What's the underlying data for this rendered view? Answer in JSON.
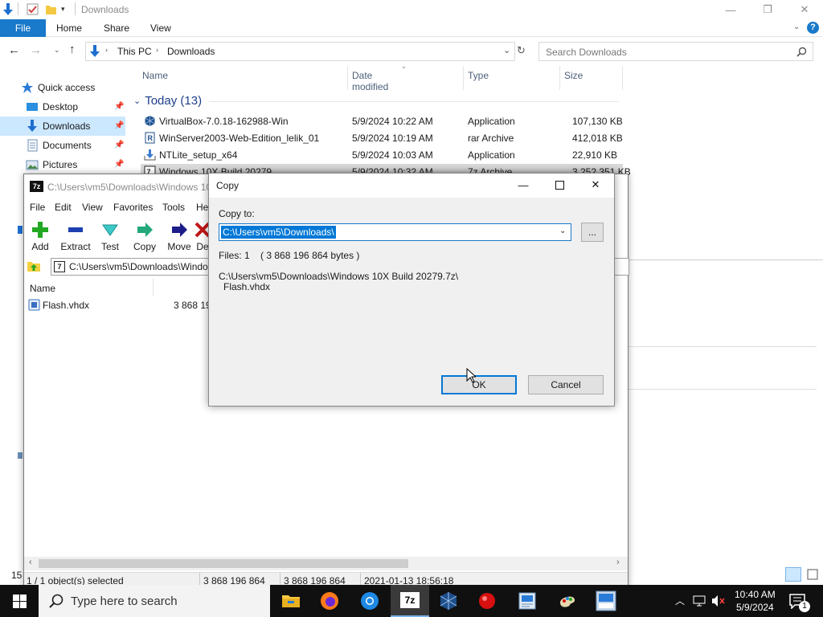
{
  "explorer": {
    "title": "Downloads",
    "ribbon_tabs": [
      "File",
      "Home",
      "Share",
      "View"
    ],
    "breadcrumb": [
      "This PC",
      "Downloads"
    ],
    "search_placeholder": "Search Downloads",
    "nav": [
      {
        "label": "Quick access",
        "icon": "star-icon"
      },
      {
        "label": "Desktop",
        "icon": "desktop-icon"
      },
      {
        "label": "Downloads",
        "icon": "download-icon"
      },
      {
        "label": "Documents",
        "icon": "documents-icon"
      },
      {
        "label": "Pictures",
        "icon": "pictures-icon"
      }
    ],
    "columns": [
      "Name",
      "Date modified",
      "Type",
      "Size"
    ],
    "group_label": "Today (13)",
    "files": [
      {
        "name": "VirtualBox-7.0.18-162988-Win",
        "date": "5/9/2024 10:22 AM",
        "type": "Application",
        "size": "107,130 KB",
        "icon": "virtualbox-icon"
      },
      {
        "name": "WinServer2003-Web-Edition_lelik_01",
        "date": "5/9/2024 10:19 AM",
        "type": "rar Archive",
        "size": "412,018 KB",
        "icon": "rar-icon"
      },
      {
        "name": "NTLite_setup_x64",
        "date": "5/9/2024 10:03 AM",
        "type": "Application",
        "size": "22,910 KB",
        "icon": "installer-icon"
      },
      {
        "name": "Windows 10X Build 20279",
        "date": "5/9/2024 10:32 AM",
        "type": "7z Archive",
        "size": "3,252,351 KB",
        "icon": "7z-file-icon"
      }
    ],
    "status_count": "15",
    "right_col_fragment": "ote"
  },
  "sevenzip": {
    "title": "C:\\Users\\vm5\\Downloads\\Windows 10",
    "menu": [
      "File",
      "Edit",
      "View",
      "Favorites",
      "Tools",
      "He"
    ],
    "toolbar": [
      {
        "label": "Add",
        "icon": "add-icon"
      },
      {
        "label": "Extract",
        "icon": "extract-icon"
      },
      {
        "label": "Test",
        "icon": "test-icon"
      },
      {
        "label": "Copy",
        "icon": "copy-icon"
      },
      {
        "label": "Move",
        "icon": "move-icon"
      },
      {
        "label": "De",
        "icon": "delete-icon"
      }
    ],
    "path": "C:\\Users\\vm5\\Downloads\\Windo",
    "list_header": "Name",
    "files": [
      {
        "name": "Flash.vhdx",
        "size": "3 868 19"
      }
    ],
    "status": {
      "selected": "1 / 1 object(s) selected",
      "size": "3 868 196 864",
      "packed": "3 868 196 864",
      "modified": "2021-01-13 18:56:18"
    }
  },
  "copy_dialog": {
    "title": "Copy",
    "copy_to_label": "Copy to:",
    "destination": "C:\\Users\\vm5\\Downloads\\",
    "browse_label": "...",
    "files_info": "Files: 1    ( 3 868 196 864 bytes )",
    "source_line1": "C:\\Users\\vm5\\Downloads\\Windows 10X Build 20279.7z\\",
    "source_line2": "Flash.vhdx",
    "ok_label": "OK",
    "cancel_label": "Cancel"
  },
  "taskbar": {
    "search_placeholder": "Type here to search",
    "time": "10:40 AM",
    "date": "5/9/2024",
    "notification_count": "1",
    "apps": [
      "file-explorer-icon",
      "firefox-icon",
      "chrome-icon",
      "7zip-icon",
      "virtualbox-icon",
      "app-red-icon",
      "photo-app-icon",
      "paint-icon",
      "win2003-icon"
    ]
  },
  "colors": {
    "accent": "#1979ca",
    "selection": "#cce8ff",
    "taskbar": "#101010",
    "dialog_bg": "#f0f0f0"
  }
}
